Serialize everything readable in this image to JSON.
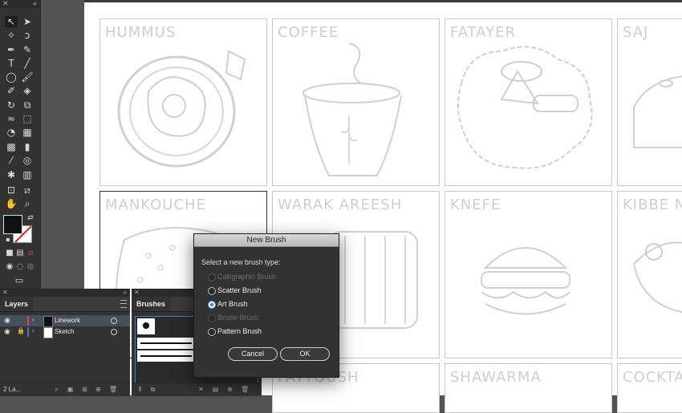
{
  "artboards": [
    {
      "label": "HUMMUS"
    },
    {
      "label": "COFFEE"
    },
    {
      "label": "FATAYER"
    },
    {
      "label": "SAJ"
    },
    {
      "label": "MANKOUCHE"
    },
    {
      "label": "WARAK AREESH"
    },
    {
      "label": "KNEFE"
    },
    {
      "label": "KIBBE N"
    },
    {
      "label": "FATTOUSH"
    },
    {
      "label": "SHAWARMA"
    },
    {
      "label": "COCKTAIL"
    }
  ],
  "layers_panel": {
    "tab": "Layers",
    "rows": [
      {
        "name": "Linework",
        "color": "#e04a4a",
        "selected": true
      },
      {
        "name": "Sketch",
        "color": "#4a6fe0",
        "selected": false
      }
    ],
    "footer_text": "2 La..."
  },
  "brushes_panel": {
    "tab": "Brushes"
  },
  "dialog": {
    "title": "New Brush",
    "prompt": "Select a new brush type:",
    "options": [
      {
        "label": "Calligraphic Brush",
        "disabled": true,
        "checked": false
      },
      {
        "label": "Scatter Brush",
        "disabled": false,
        "checked": false
      },
      {
        "label": "Art Brush",
        "disabled": false,
        "checked": true
      },
      {
        "label": "Bristle Brush",
        "disabled": true,
        "checked": false
      },
      {
        "label": "Pattern Brush",
        "disabled": false,
        "checked": false
      }
    ],
    "cancel_label": "Cancel",
    "ok_label": "OK"
  }
}
